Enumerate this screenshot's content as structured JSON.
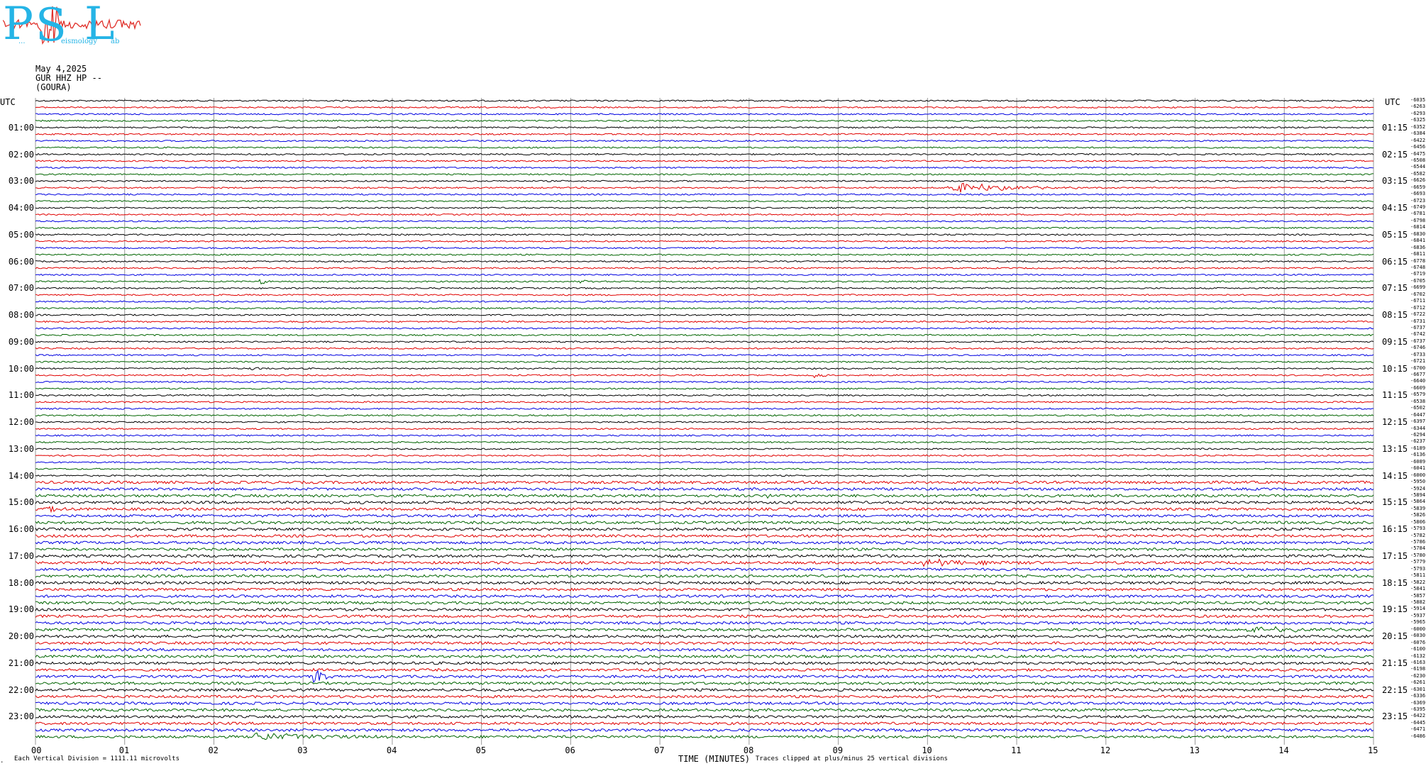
{
  "logo": {
    "letters": [
      "P",
      "S",
      "L"
    ],
    "small_left": "...",
    "small_mid": "eismology",
    "small_right": "ab",
    "color": "#25b4e6",
    "wave_color": "#e0302a"
  },
  "header": {
    "date": "May 4,2025",
    "station": "GUR HHZ HP --",
    "location": "(GOURA)"
  },
  "chart_data": {
    "type": "line",
    "title": "May 4,2025",
    "xlabel": "TIME (MINUTES)",
    "xlim": [
      0,
      15
    ],
    "x_ticks": [
      "00",
      "01",
      "02",
      "03",
      "04",
      "05",
      "06",
      "07",
      "08",
      "09",
      "10",
      "11",
      "12",
      "13",
      "14",
      "15"
    ],
    "trace_colors": [
      "#000000",
      "#e00000",
      "#0000e0",
      "#006400"
    ],
    "trace_count": 96,
    "minutes_per_trace": 15,
    "left_axis_title": "UTC",
    "right_axis_title": "UTC",
    "left_hours": [
      "01:00",
      "02:00",
      "03:00",
      "04:00",
      "05:00",
      "06:00",
      "07:00",
      "08:00",
      "09:00",
      "10:00",
      "11:00",
      "12:00",
      "13:00",
      "14:00",
      "15:00",
      "16:00",
      "17:00",
      "18:00",
      "19:00",
      "20:00",
      "21:00",
      "22:00",
      "23:00"
    ],
    "right_hours": [
      "01:15",
      "02:15",
      "03:15",
      "04:15",
      "05:15",
      "06:15",
      "07:15",
      "08:15",
      "09:15",
      "10:15",
      "11:15",
      "12:15",
      "13:15",
      "14:15",
      "15:15",
      "16:15",
      "17:15",
      "18:15",
      "19:15",
      "20:15",
      "21:15",
      "22:15",
      "23:15"
    ],
    "trace_counts": [
      "-6035",
      "-6263",
      "-6293",
      "-6325",
      "-6352",
      "-6384",
      "-6422",
      "-6456",
      "-6475",
      "-6508",
      "-6544",
      "-6582",
      "-6626",
      "-6659",
      "-6693",
      "-6723",
      "-6749",
      "-6781",
      "-6798",
      "-6814",
      "-6830",
      "-6841",
      "-6836",
      "-6811",
      "-6778",
      "-6748",
      "-6719",
      "-6705",
      "-6699",
      "-6702",
      "-6711",
      "-6712",
      "-6722",
      "-6731",
      "-6737",
      "-6742",
      "-6737",
      "-6746",
      "-6733",
      "-6721",
      "-6700",
      "-6677",
      "-6640",
      "-6609",
      "-6579",
      "-6538",
      "-6502",
      "-6447",
      "-6397",
      "-6344",
      "-6294",
      "-6237",
      "-6189",
      "-6136",
      "-6089",
      "-6041",
      "-6000",
      "-5950",
      "-5924",
      "-5894",
      "-5864",
      "-5839",
      "-5826",
      "-5806",
      "-5793",
      "-5782",
      "-5786",
      "-5784",
      "-5780",
      "-5779",
      "-5793",
      "-5811",
      "-5822",
      "-5841",
      "-5857",
      "-5882",
      "-5914",
      "-5937",
      "-5965",
      "-6000",
      "-6030",
      "-6076",
      "-6100",
      "-6132",
      "-6163",
      "-6198",
      "-6230",
      "-6261",
      "-6301",
      "-6336",
      "-6369",
      "-6395",
      "-6422",
      "-6445",
      "-6471",
      "-6486"
    ],
    "events": [
      {
        "trace": 13,
        "x_min": 10.2,
        "x_max": 11.8,
        "amp": 10
      },
      {
        "trace": 27,
        "x_min": 2.5,
        "x_max": 2.7,
        "amp": 6
      },
      {
        "trace": 27,
        "x_min": 6.1,
        "x_max": 6.3,
        "amp": 4
      },
      {
        "trace": 40,
        "x_min": 2.4,
        "x_max": 2.7,
        "amp": 3
      },
      {
        "trace": 41,
        "x_min": 8.7,
        "x_max": 9.0,
        "amp": 8
      },
      {
        "trace": 59,
        "x_min": 8.2,
        "x_max": 8.35,
        "amp": 5
      },
      {
        "trace": 61,
        "x_min": 0.1,
        "x_max": 0.4,
        "amp": 7
      },
      {
        "trace": 69,
        "x_min": 9.9,
        "x_max": 11.4,
        "amp": 6
      },
      {
        "trace": 79,
        "x_min": 13.5,
        "x_max": 15.0,
        "amp": 6
      },
      {
        "trace": 86,
        "x_min": 3.1,
        "x_max": 3.4,
        "amp": 16
      },
      {
        "trace": 95,
        "x_min": 2.4,
        "x_max": 4.2,
        "amp": 7
      }
    ]
  },
  "footer": {
    "division": "Each Vertical Division = 1111.11 microvolts",
    "clipped": "Traces clipped at plus/minus 25 vertical divisions",
    "corner_mark": "."
  }
}
